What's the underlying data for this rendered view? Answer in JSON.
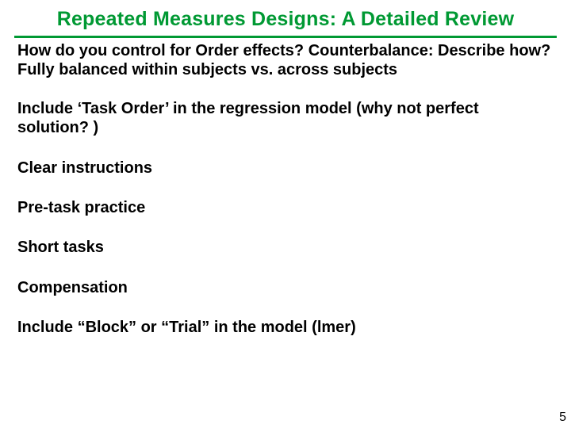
{
  "title": "Repeated Measures Designs:  A Detailed Review",
  "points": [
    "How do  you control for Order effects?  Counterbalance:  Describe how?  Fully balanced within subjects vs. across subjects",
    "Include ‘Task Order’ in the regression model (why not perfect solution? )",
    "Clear instructions",
    "Pre-task practice",
    "Short tasks",
    "Compensation",
    "Include “Block” or “Trial” in the model (lmer)"
  ],
  "page_number": "5",
  "colors": {
    "accent": "#009933",
    "text": "#000000",
    "background": "#ffffff"
  }
}
